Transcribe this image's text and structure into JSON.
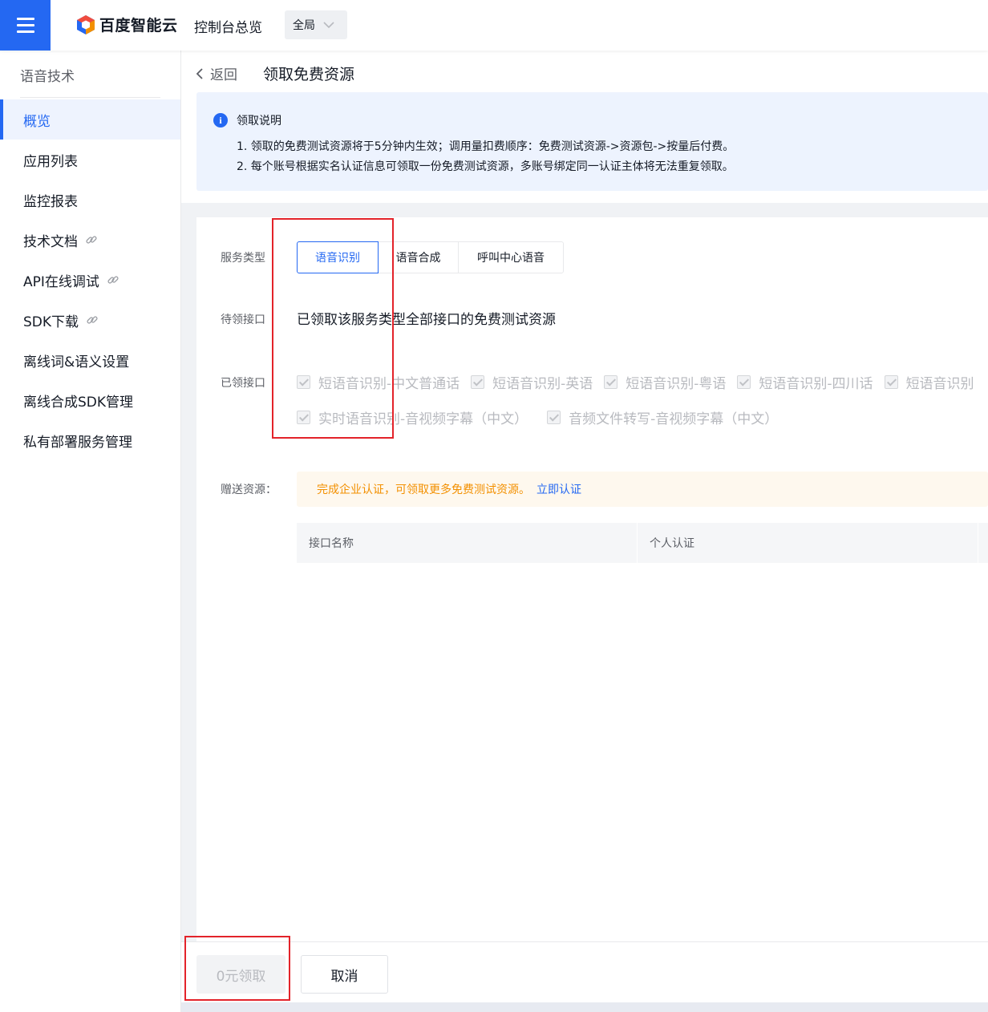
{
  "topbar": {
    "brand": "百度智能云",
    "console_link": "控制台总览",
    "region": "全局"
  },
  "sidebar": {
    "title": "语音技术",
    "items": [
      {
        "label": "概览",
        "active": true,
        "external": false
      },
      {
        "label": "应用列表",
        "active": false,
        "external": false
      },
      {
        "label": "监控报表",
        "active": false,
        "external": false
      },
      {
        "label": "技术文档",
        "active": false,
        "external": true
      },
      {
        "label": "API在线调试",
        "active": false,
        "external": true
      },
      {
        "label": "SDK下载",
        "active": false,
        "external": true
      },
      {
        "label": "离线词&语义设置",
        "active": false,
        "external": false
      },
      {
        "label": "离线合成SDK管理",
        "active": false,
        "external": false
      },
      {
        "label": "私有部署服务管理",
        "active": false,
        "external": false
      }
    ]
  },
  "header": {
    "back": "返回",
    "title": "领取免费资源"
  },
  "notice": {
    "title": "领取说明",
    "lines": [
      "1. 领取的免费测试资源将于5分钟内生效；调用量扣费顺序：免费测试资源->资源包->按量后付费。",
      "2. 每个账号根据实名认证信息可领取一份免费测试资源，多账号绑定同一认证主体将无法重复领取。"
    ]
  },
  "form": {
    "service_type_label": "服务类型",
    "tabs": [
      "语音识别",
      "语音合成",
      "呼叫中心语音"
    ],
    "pending_label": "待领接口",
    "pending_text": "已领取该服务类型全部接口的免费测试资源",
    "claimed_label": "已领接口",
    "claimed_row1": [
      "短语音识别-中文普通话",
      "短语音识别-英语",
      "短语音识别-粤语",
      "短语音识别-四川话",
      "短语音识别"
    ],
    "claimed_row2": [
      "实时语音识别-音视频字幕（中文）",
      "音频文件转写-音视频字幕（中文）"
    ],
    "gift_label": "赠送资源：",
    "gift_text": "完成企业认证，可领取更多免费测试资源。",
    "gift_link": "立即认证",
    "table_headers": [
      "接口名称",
      "个人认证"
    ]
  },
  "footer": {
    "claim_button": "0元领取",
    "cancel_button": "取消"
  },
  "colors": {
    "accent": "#2468f2",
    "warning": "#f39000",
    "annotation": "#e3232a"
  }
}
